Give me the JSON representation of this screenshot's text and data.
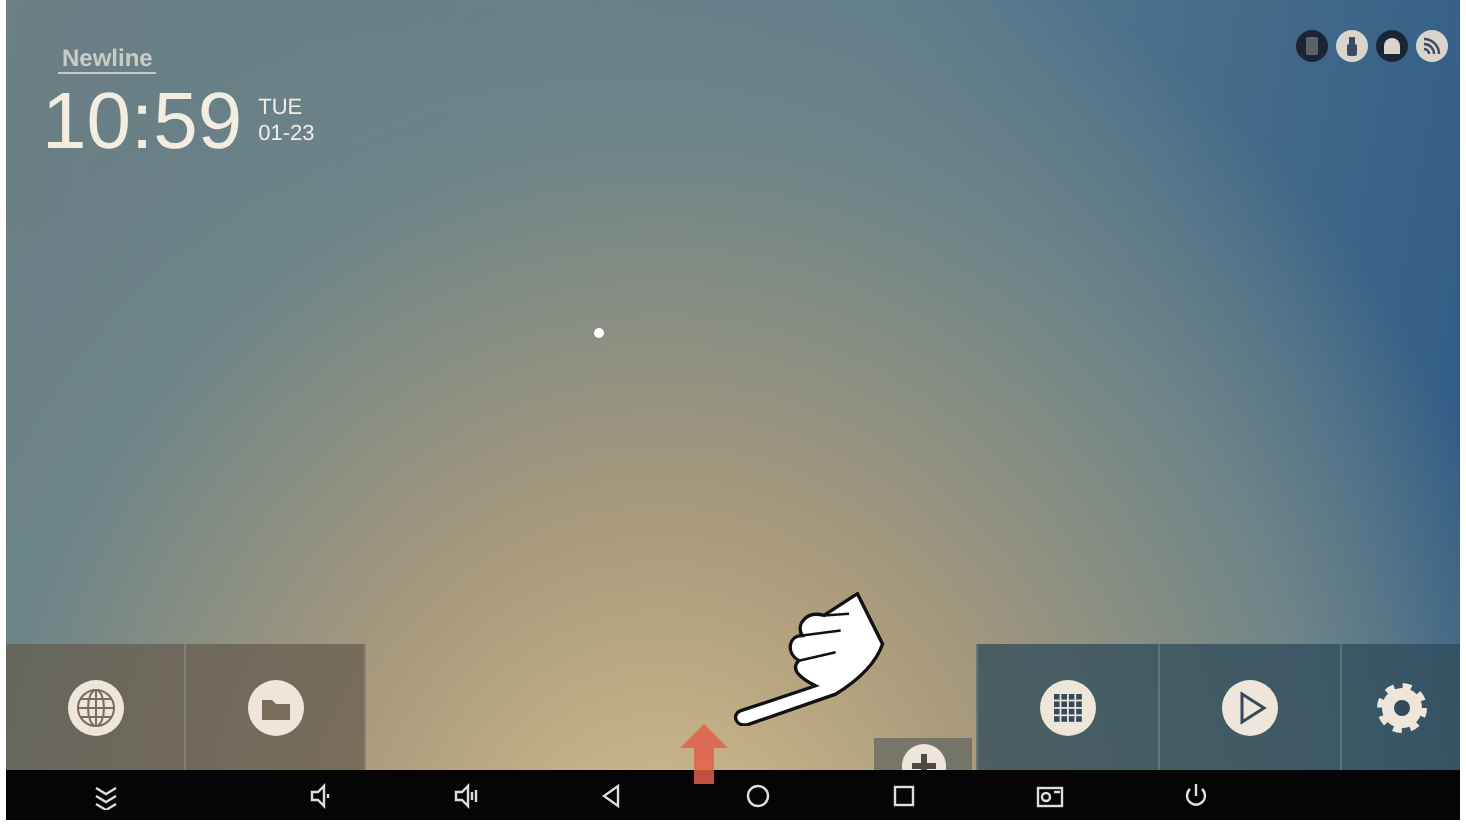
{
  "logo": {
    "text": "Newline"
  },
  "clock": {
    "time": "10:59",
    "day": "TUE",
    "date": "01-23"
  },
  "status_icons": [
    {
      "kind": "sd",
      "on": false
    },
    {
      "kind": "usb",
      "on": true
    },
    {
      "kind": "ethernet",
      "on": false
    },
    {
      "kind": "wifi",
      "on": true
    }
  ],
  "left_tiles": [
    {
      "kind": "globe"
    },
    {
      "kind": "folder"
    }
  ],
  "small_tile": {
    "kind": "plus"
  },
  "right_tiles": [
    {
      "kind": "apps"
    },
    {
      "kind": "play"
    },
    {
      "kind": "settings"
    }
  ],
  "nav_bar": [
    {
      "kind": "collapse"
    },
    {
      "kind": "volume_down"
    },
    {
      "kind": "volume_up"
    },
    {
      "kind": "back"
    },
    {
      "kind": "home"
    },
    {
      "kind": "recents"
    },
    {
      "kind": "screenshot"
    },
    {
      "kind": "power"
    }
  ]
}
